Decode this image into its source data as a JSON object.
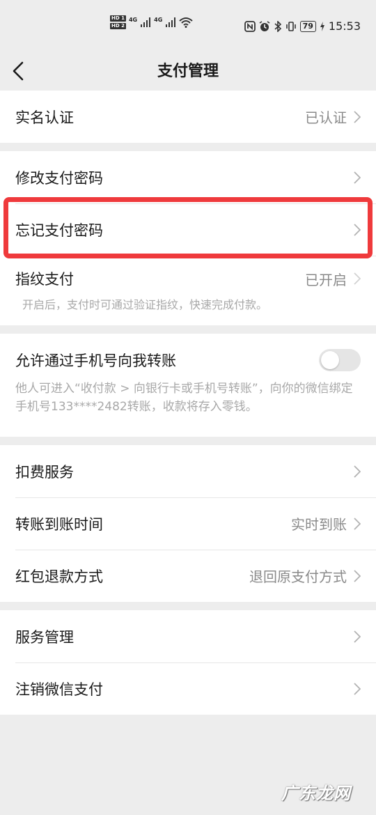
{
  "status_bar": {
    "hd1": "HD 1",
    "hd2": "HD 2",
    "sig1": "4G",
    "sig2": "4G",
    "battery": "79",
    "time": "15:53"
  },
  "nav": {
    "title": "支付管理"
  },
  "groups": {
    "realname": {
      "label": "实名认证",
      "value": "已认证"
    },
    "modify_pwd": {
      "label": "修改支付密码"
    },
    "forgot_pwd": {
      "label": "忘记支付密码"
    },
    "fingerprint": {
      "label": "指纹支付",
      "value": "已开启",
      "desc": "开启后，支付时可通过验证指纹，快速完成付款。"
    },
    "phone_transfer": {
      "label": "允许通过手机号向我转账",
      "desc": "他人可进入“收付款 > 向银行卡或手机号转账”，向你的微信绑定手机号133****2482转账，收款将存入零钱。",
      "enabled": false
    },
    "deduct": {
      "label": "扣费服务"
    },
    "arrival_time": {
      "label": "转账到账时间",
      "value": "实时到账"
    },
    "refund": {
      "label": "红包退款方式",
      "value": "退回原支付方式"
    },
    "service_mgmt": {
      "label": "服务管理"
    },
    "cancel_pay": {
      "label": "注销微信支付"
    }
  },
  "watermark": "广东龙网",
  "colors": {
    "highlight": "#ef3a3c",
    "background": "#ededed"
  }
}
